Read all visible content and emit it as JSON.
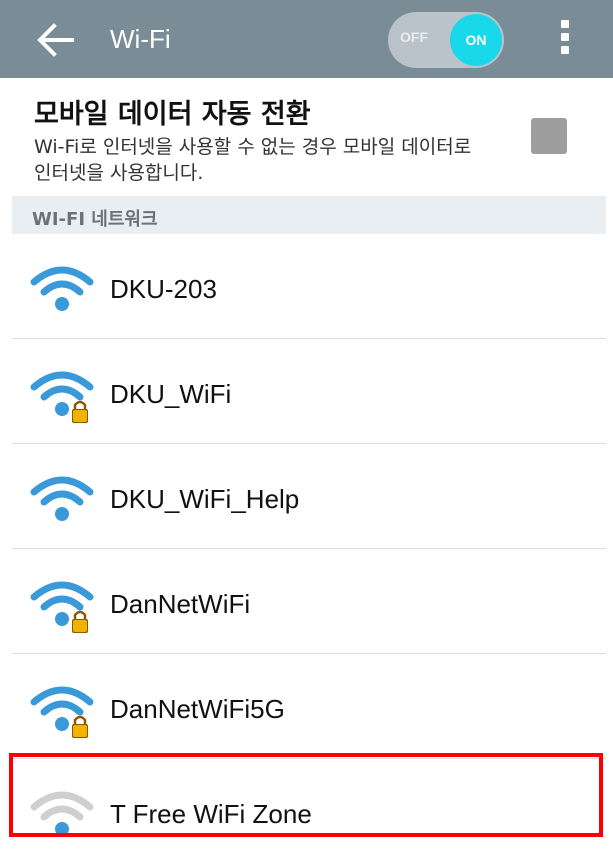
{
  "header": {
    "title": "Wi-Fi",
    "toggle_off_label": "OFF",
    "toggle_on_label": "ON",
    "toggle_state": "on",
    "back_icon": "back-arrow-icon",
    "menu_icon": "more-vert-icon"
  },
  "mobile_data_switch": {
    "title": "모바일 데이터 자동 전환",
    "description": "Wi-Fi로 인터넷을 사용할 수 없는 경우 모바일 데이터로  인터넷을 사용합니다.",
    "checked": false
  },
  "section": {
    "title": "WI-FI 네트워크"
  },
  "networks": [
    {
      "name": "DKU-203",
      "secured": false,
      "color": "#3a9ad9"
    },
    {
      "name": "DKU_WiFi",
      "secured": true,
      "color": "#3a9ad9"
    },
    {
      "name": "DKU_WiFi_Help",
      "secured": false,
      "color": "#3a9ad9"
    },
    {
      "name": "DanNetWiFi",
      "secured": true,
      "color": "#3a9ad9"
    },
    {
      "name": "DanNetWiFi5G",
      "secured": true,
      "color": "#3a9ad9"
    },
    {
      "name": "T Free WiFi Zone",
      "secured": false,
      "color": "#3a9ad9",
      "weak": true
    }
  ],
  "colors": {
    "header_bg": "#7a8c96",
    "toggle_on": "#19d8ea",
    "highlight": "#ff0000"
  }
}
